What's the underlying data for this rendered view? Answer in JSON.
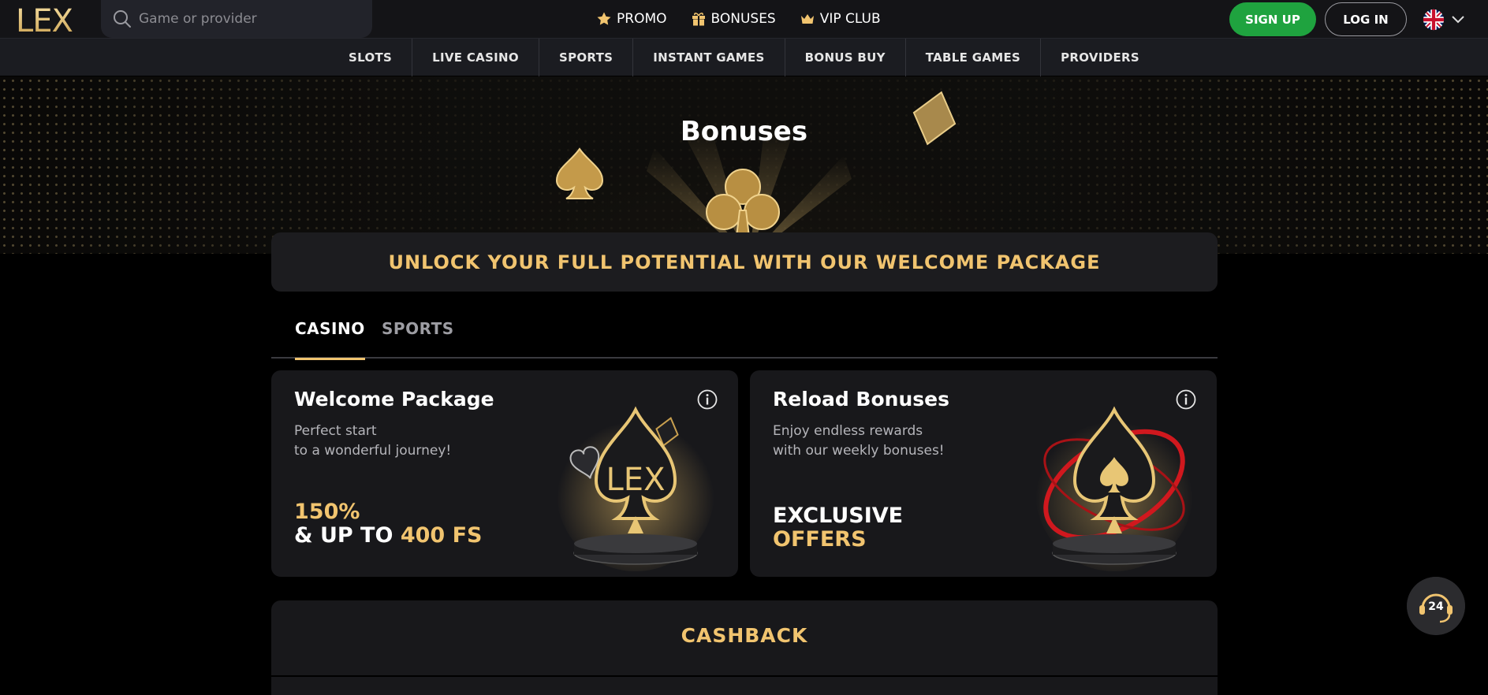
{
  "header": {
    "logo_text": "LEX",
    "search_placeholder": "Game or provider",
    "nav": [
      {
        "label": "PROMO",
        "icon": "star-icon"
      },
      {
        "label": "BONUSES",
        "icon": "gift-icon"
      },
      {
        "label": "VIP CLUB",
        "icon": "crown-icon"
      }
    ],
    "signup_label": "SIGN UP",
    "login_label": "LOG IN",
    "language_icon": "uk-flag-icon"
  },
  "categories": [
    "SLOTS",
    "LIVE CASINO",
    "SPORTS",
    "INSTANT GAMES",
    "BONUS BUY",
    "TABLE GAMES",
    "PROVIDERS"
  ],
  "hero": {
    "title": "Bonuses"
  },
  "welcome_banner": "UNLOCK YOUR FULL POTENTIAL WITH OUR WELCOME PACKAGE",
  "tabs": [
    {
      "label": "CASINO",
      "active": true
    },
    {
      "label": "SPORTS",
      "active": false
    }
  ],
  "cards": [
    {
      "title": "Welcome Package",
      "desc_line1": "Perfect start",
      "desc_line2": "to a wonderful journey!",
      "offer_line1": "150%",
      "offer_line2_prefix": "& UP TO ",
      "offer_line2_highlight": "400 FS",
      "art_text": "LEX"
    },
    {
      "title": "Reload Bonuses",
      "desc_line1": "Enjoy endless rewards",
      "desc_line2": "with our weekly bonuses!",
      "offer_line1": "EXCLUSIVE",
      "offer_line2": "OFFERS"
    }
  ],
  "cashback": {
    "title": "CASHBACK"
  },
  "support": {
    "label": "24"
  },
  "colors": {
    "accent_gold": "#f1c46f",
    "signup_green": "#1fa33f",
    "background": "#000000",
    "card": "#18181b"
  }
}
